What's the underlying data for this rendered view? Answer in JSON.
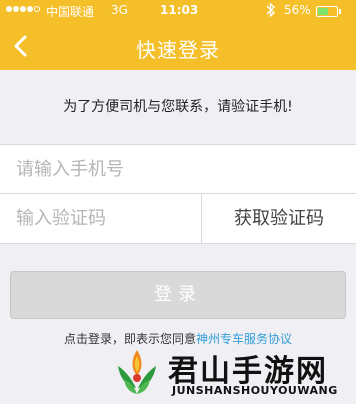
{
  "status_bar": {
    "carrier": "中国联通",
    "network": "3G",
    "time": "11:03",
    "battery_percent": "56%",
    "battery_level": 0.56,
    "signal_bars": 4,
    "signal_max": 5,
    "icons": [
      "signal-icon",
      "bluetooth-icon",
      "battery-icon"
    ]
  },
  "nav": {
    "title": "快速登录",
    "back_icon": "chevron-left-icon"
  },
  "hint": "为了方便司机与您联系，请验证手机!",
  "form": {
    "phone_placeholder": "请输入手机号",
    "phone_value": "",
    "code_placeholder": "输入验证码",
    "code_value": "",
    "get_code_label": "获取验证码"
  },
  "login_button": "登录",
  "agreement": {
    "prefix": "点击登录，即表示您同意",
    "link": "神州专车服务协议"
  },
  "watermark": {
    "name": "君山手游网",
    "sub": "JUNSHANSHOUYOUWANG"
  },
  "colors": {
    "accent": "#f5bf2a",
    "link": "#2f9fd8",
    "button_disabled": "#d9d9d9",
    "background": "#f0eff4"
  }
}
